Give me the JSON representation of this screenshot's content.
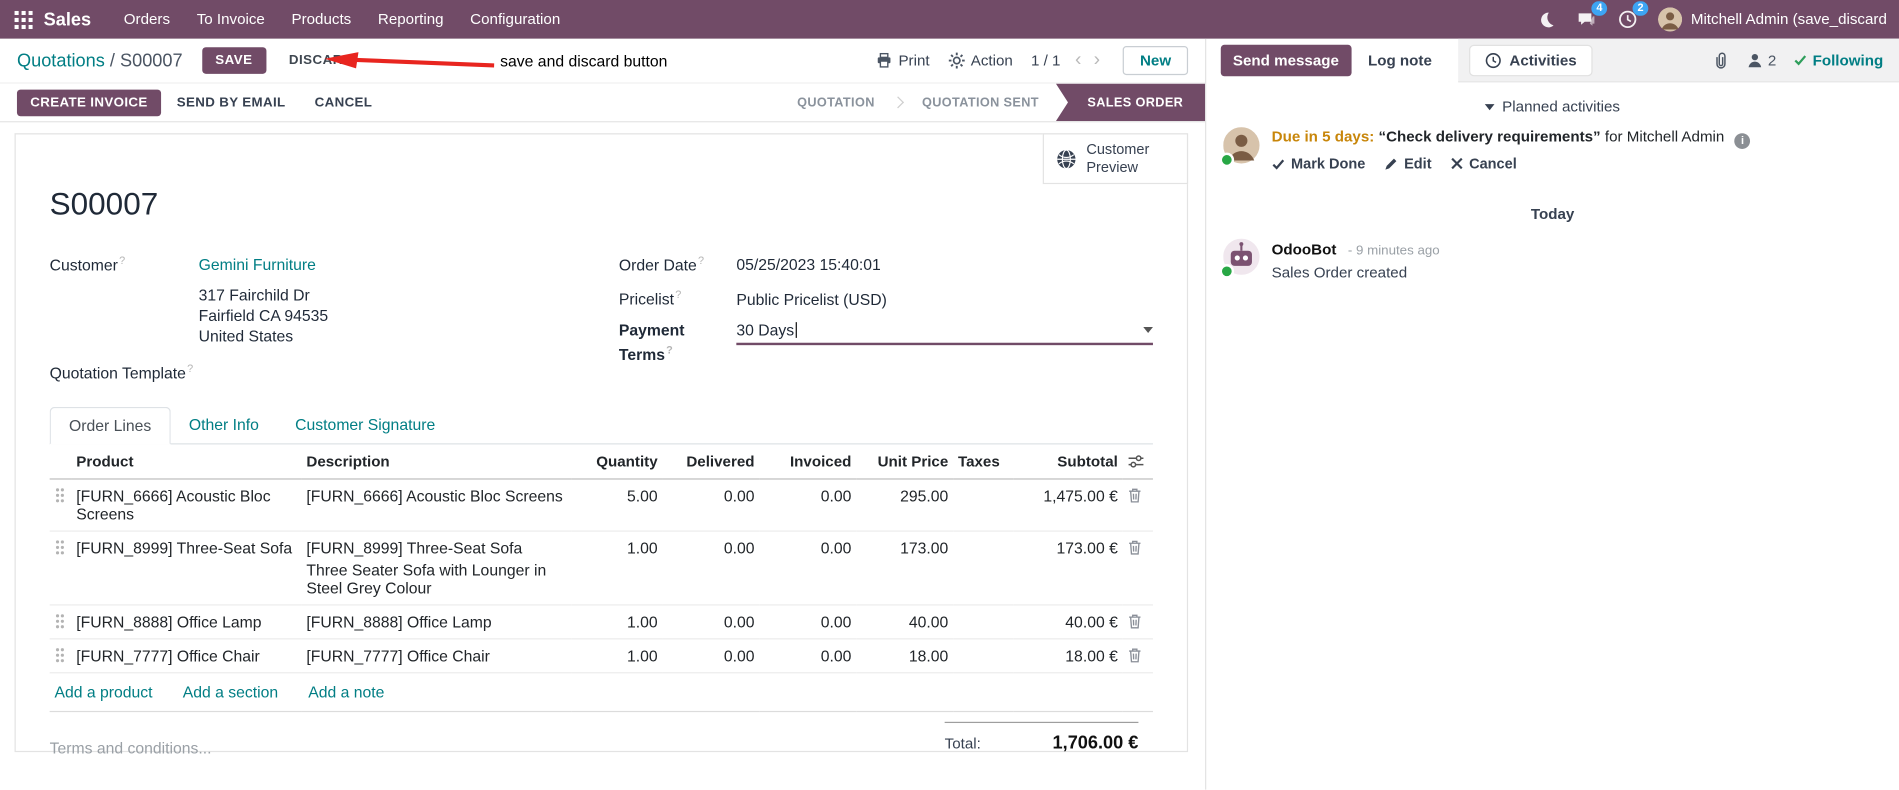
{
  "topbar": {
    "app": "Sales",
    "menus": [
      "Orders",
      "To Invoice",
      "Products",
      "Reporting",
      "Configuration"
    ],
    "message_badge": "4",
    "activity_badge": "2",
    "user": "Mitchell Admin (save_discard"
  },
  "control": {
    "breadcrumb_parent": "Quotations",
    "breadcrumb_sep": "/",
    "breadcrumb_current": "S00007",
    "save": "SAVE",
    "discard": "DISCARD",
    "print": "Print",
    "action": "Action",
    "pager": "1 / 1",
    "new": "New"
  },
  "annotation": {
    "text": "save and discard button"
  },
  "statusbar": {
    "create_invoice": "CREATE INVOICE",
    "send_by_email": "SEND BY EMAIL",
    "cancel": "CANCEL",
    "states": [
      "QUOTATION",
      "QUOTATION SENT",
      "SALES ORDER"
    ],
    "active_state": "SALES ORDER"
  },
  "form": {
    "customer_preview": "Customer Preview",
    "title": "S00007",
    "help_mark": "?",
    "customer_label": "Customer",
    "customer": "Gemini Furniture",
    "address_line1": "317 Fairchild Dr",
    "address_line2": "Fairfield CA 94535",
    "address_line3": "United States",
    "quotation_template_label": "Quotation Template",
    "order_date_label": "Order Date",
    "order_date": "05/25/2023 15:40:01",
    "pricelist_label": "Pricelist",
    "pricelist": "Public Pricelist (USD)",
    "payment_terms_label": "Payment Terms",
    "payment_terms": "30 Days"
  },
  "tabs": {
    "order_lines": "Order Lines",
    "other_info": "Other Info",
    "customer_signature": "Customer Signature"
  },
  "order_lines": {
    "headers": {
      "product": "Product",
      "description": "Description",
      "quantity": "Quantity",
      "delivered": "Delivered",
      "invoiced": "Invoiced",
      "unit_price": "Unit Price",
      "taxes": "Taxes",
      "subtotal": "Subtotal"
    },
    "rows": [
      {
        "product": "[FURN_6666] Acoustic Bloc Screens",
        "desc": "[FURN_6666] Acoustic Bloc Screens",
        "qty": "5.00",
        "delivered": "0.00",
        "invoiced": "0.00",
        "price": "295.00",
        "subtotal": "1,475.00 €"
      },
      {
        "product": "[FURN_8999] Three-Seat Sofa",
        "desc": "[FURN_8999] Three-Seat Sofa",
        "desc2": "Three Seater Sofa with Lounger in Steel Grey Colour",
        "qty": "1.00",
        "delivered": "0.00",
        "invoiced": "0.00",
        "price": "173.00",
        "subtotal": "173.00 €"
      },
      {
        "product": "[FURN_8888] Office Lamp",
        "desc": "[FURN_8888] Office Lamp",
        "qty": "1.00",
        "delivered": "0.00",
        "invoiced": "0.00",
        "price": "40.00",
        "subtotal": "40.00 €"
      },
      {
        "product": "[FURN_7777] Office Chair",
        "desc": "[FURN_7777] Office Chair",
        "qty": "1.00",
        "delivered": "0.00",
        "invoiced": "0.00",
        "price": "18.00",
        "subtotal": "18.00 €"
      }
    ],
    "add_product": "Add a product",
    "add_section": "Add a section",
    "add_note": "Add a note",
    "terms_placeholder": "Terms and conditions...",
    "total_label": "Total:",
    "total": "1,706.00 €"
  },
  "chatter": {
    "send_message": "Send message",
    "log_note": "Log note",
    "activities_tab": "Activities",
    "followers_count": "2",
    "following": "Following",
    "planned_activities": "Planned activities",
    "activity_due": "Due in 5 days:",
    "activity_summary": "“Check delivery requirements”",
    "activity_for": "for Mitchell Admin",
    "mark_done": "Mark Done",
    "edit": "Edit",
    "cancel": "Cancel",
    "date_divider": "Today",
    "message_author": "OdooBot",
    "message_time": "- 9 minutes ago",
    "message_body": "Sales Order created"
  },
  "colors": {
    "brand": "#714B67",
    "link": "#017e84",
    "badge_blue": "#3da5f4",
    "due_orange": "#c8860a",
    "arrow_red": "#e8251f"
  }
}
